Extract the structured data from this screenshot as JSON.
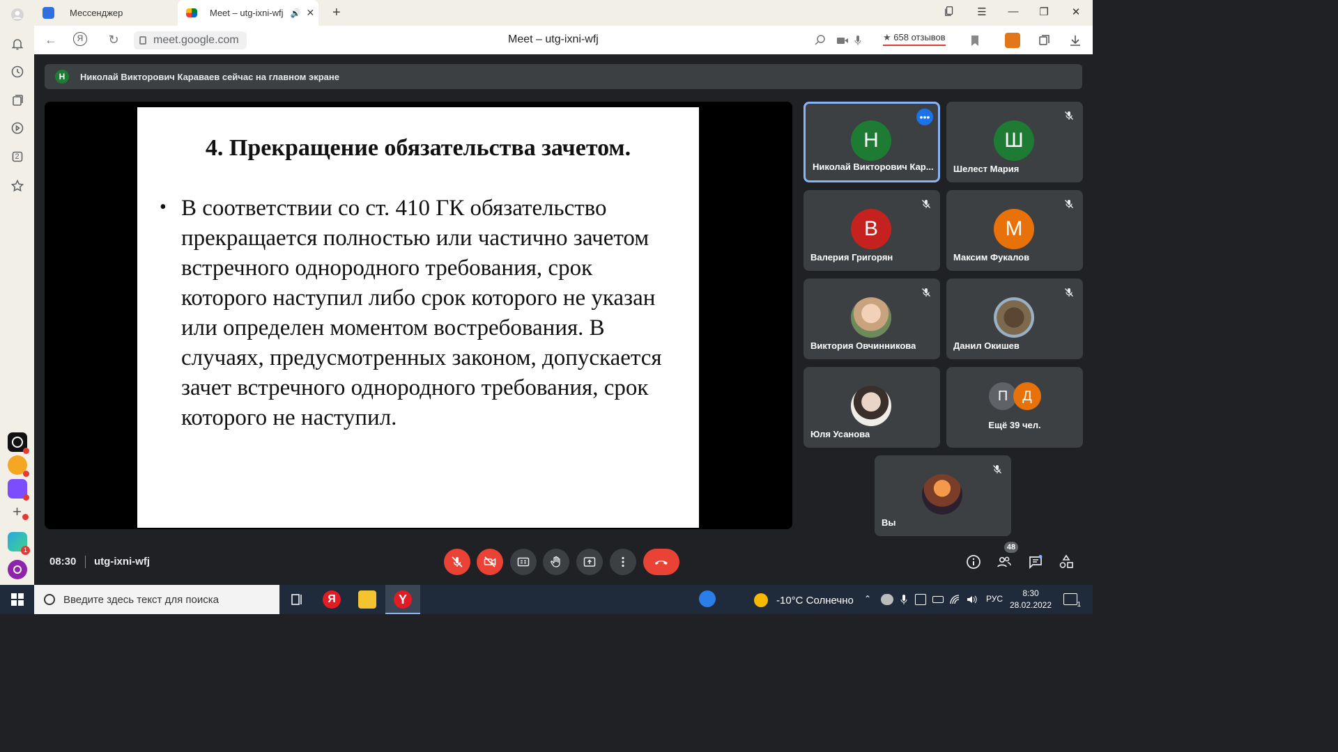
{
  "browser": {
    "tabs": [
      {
        "label": "Мессенджер",
        "active": false
      },
      {
        "label": "Meet – utg-ixni-wfj",
        "active": true
      }
    ],
    "url": "meet.google.com",
    "page_title": "Meet – utg-ixni-wfj",
    "reviews": "658 отзывов",
    "reviews_star": "★"
  },
  "banner": {
    "avatar_letter": "Н",
    "text": "Николай Викторович Караваев сейчас на главном экране"
  },
  "slide": {
    "title": "4. Прекращение обязательства зачетом.",
    "bullet": "•",
    "body": "В соответствии со ст. 410 ГК обязательство прекращается полностью или частично зачетом встречного однородного требования, срок которого наступил либо срок которого не указан или определен моментом востребования. В случаях, предусмотренных законом, допускается зачет встречного однородного требования, срок которого не наступил."
  },
  "participants": [
    {
      "name": "Николай Викторович Кар...",
      "letter": "Н",
      "color": "#1e7b34",
      "muted": false,
      "active": true
    },
    {
      "name": "Шелест Мария",
      "letter": "Ш",
      "color": "#1e7b34",
      "muted": true
    },
    {
      "name": "Валерия Григорян",
      "letter": "В",
      "color": "#c5221f",
      "muted": true
    },
    {
      "name": "Максим Фукалов",
      "letter": "М",
      "color": "#e8710a",
      "muted": true
    },
    {
      "name": "Виктория Овчинникова",
      "letter": "",
      "color": "photo",
      "muted": true
    },
    {
      "name": "Данил Окишев",
      "letter": "",
      "color": "photo",
      "muted": true
    },
    {
      "name": "Юля Усанова",
      "letter": "",
      "color": "photo",
      "muted": false
    },
    {
      "name": "Вы",
      "letter": "",
      "color": "photo",
      "muted": true
    }
  ],
  "more_tile": {
    "letters": [
      "П",
      "Д"
    ],
    "label": "Ещё 39 чел."
  },
  "controls": {
    "time": "08:30",
    "meeting_code": "utg-ixni-wfj",
    "participant_count": "48"
  },
  "taskbar": {
    "search_placeholder": "Введите здесь текст для поиска",
    "yandex_letter": "Я",
    "weather": "-10°C  Солнечно",
    "language": "РУС",
    "time": "8:30",
    "date": "28.02.2022"
  },
  "sidebar": {
    "count_badge": "2",
    "notif_count": "1"
  }
}
